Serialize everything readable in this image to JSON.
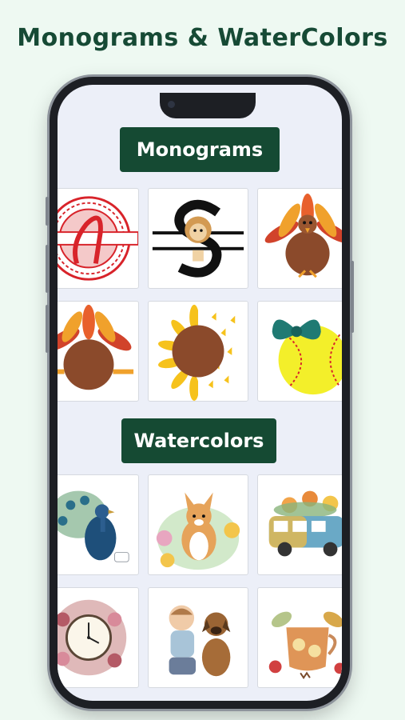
{
  "headline": "Monograms & WaterColors",
  "sections": {
    "monograms": {
      "label": "Monograms",
      "items": [
        {
          "name": "mandala-letter-monogram-icon"
        },
        {
          "name": "lion-letter-s-monogram-icon"
        },
        {
          "name": "turkey-monogram-icon"
        },
        {
          "name": "turkey-circle-monogram-icon"
        },
        {
          "name": "sunflower-butterfly-monogram-icon"
        },
        {
          "name": "softball-bow-monogram-icon"
        }
      ]
    },
    "watercolors": {
      "label": "Watercolors",
      "items": [
        {
          "name": "peacock-watercolor-icon"
        },
        {
          "name": "corgi-flowers-watercolor-icon"
        },
        {
          "name": "floral-van-watercolor-icon"
        },
        {
          "name": "floral-clock-watercolor-icon"
        },
        {
          "name": "boy-and-puppy-watercolor-icon"
        },
        {
          "name": "tea-cup-watercolor-icon"
        }
      ]
    }
  },
  "colors": {
    "background": "#eef9f2",
    "accent": "#154a33",
    "screen": "#eceff8"
  }
}
